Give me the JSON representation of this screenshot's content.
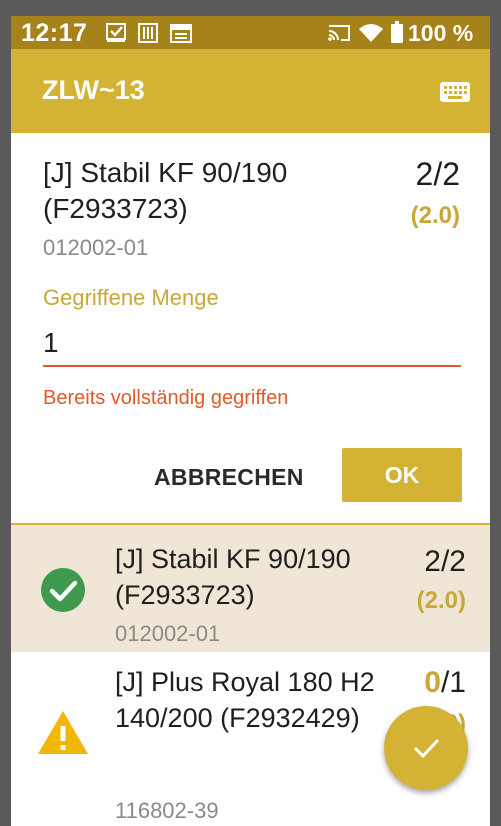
{
  "status_bar": {
    "time": "12:17",
    "battery": "100 %"
  },
  "app_bar": {
    "title": "ZLW~13",
    "keyboard_icon": "keyboard-icon"
  },
  "dialog": {
    "item_title": "[J] Stabil KF 90/190 (F2933723)",
    "item_code": "012002-01",
    "qty": "2/2",
    "qty_sub": "(2.0)",
    "field_label": "Gegriffene Menge",
    "field_value": "1",
    "error_text": "Bereits vollständig gegriffen",
    "cancel_label": "ABBRECHEN",
    "ok_label": "OK"
  },
  "list": [
    {
      "status_icon": "check-circle-icon",
      "title": "[J] Stabil KF 90/190 (F2933723)",
      "code": "012002-01",
      "qty": "2/2",
      "qty_sub": "(2.0)"
    },
    {
      "status_icon": "warning-icon",
      "title": "[J] Plus Royal 180 H2 140/200 (F2932429)",
      "code": "116802-39",
      "qty_picked": "0",
      "qty_total": "/1",
      "qty_sub": "(0.0)"
    }
  ],
  "colors": {
    "accent": "#d4b334",
    "status_bar": "#a6831a",
    "error": "#e05a2b",
    "done_row": "#f0e6d6",
    "success": "#3f9a4f",
    "warning": "#f2b705"
  }
}
